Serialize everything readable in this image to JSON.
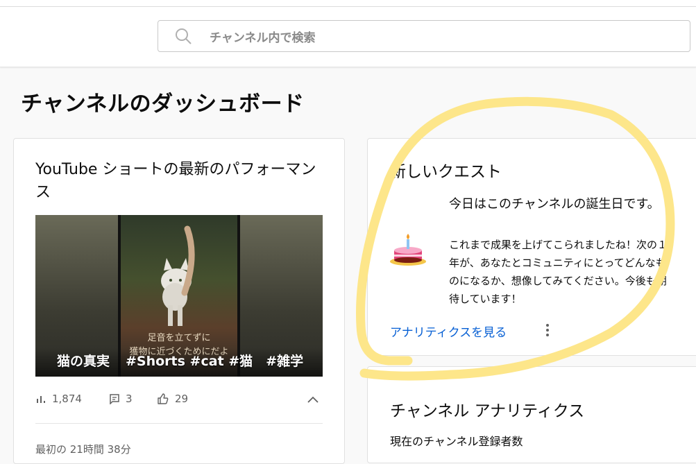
{
  "search": {
    "placeholder": "チャンネル内で検索"
  },
  "page_title": "チャンネルのダッシュボード",
  "shorts_card": {
    "title": "YouTube ショートの最新のパフォーマンス",
    "thumbnail": {
      "subtitle_line1": "足音を立てずに",
      "subtitle_line2": "獲物に近づくためにだよ",
      "caption_left": "猫の真実",
      "caption_right": "#Shorts #cat #猫　#雑学"
    },
    "views": "1,874",
    "comments": "3",
    "likes": "29",
    "footer": "最初の 21時間 38分"
  },
  "quest_card": {
    "title": "新しいクエスト",
    "heading": "今日はこのチャンネルの誕生日です。",
    "body": "これまで成果を上げてこられましたね！次の１年が、あなたとコミュニティにとってどんなものになるか、想像してみてください。今後も期待しています！",
    "link": "アナリティクスを見る"
  },
  "analytics_card": {
    "title": "チャンネル アナリティクス",
    "subtitle": "現在のチャンネル登録者数"
  },
  "colors": {
    "link": "#065fd4",
    "highlight": "#fde68a"
  }
}
